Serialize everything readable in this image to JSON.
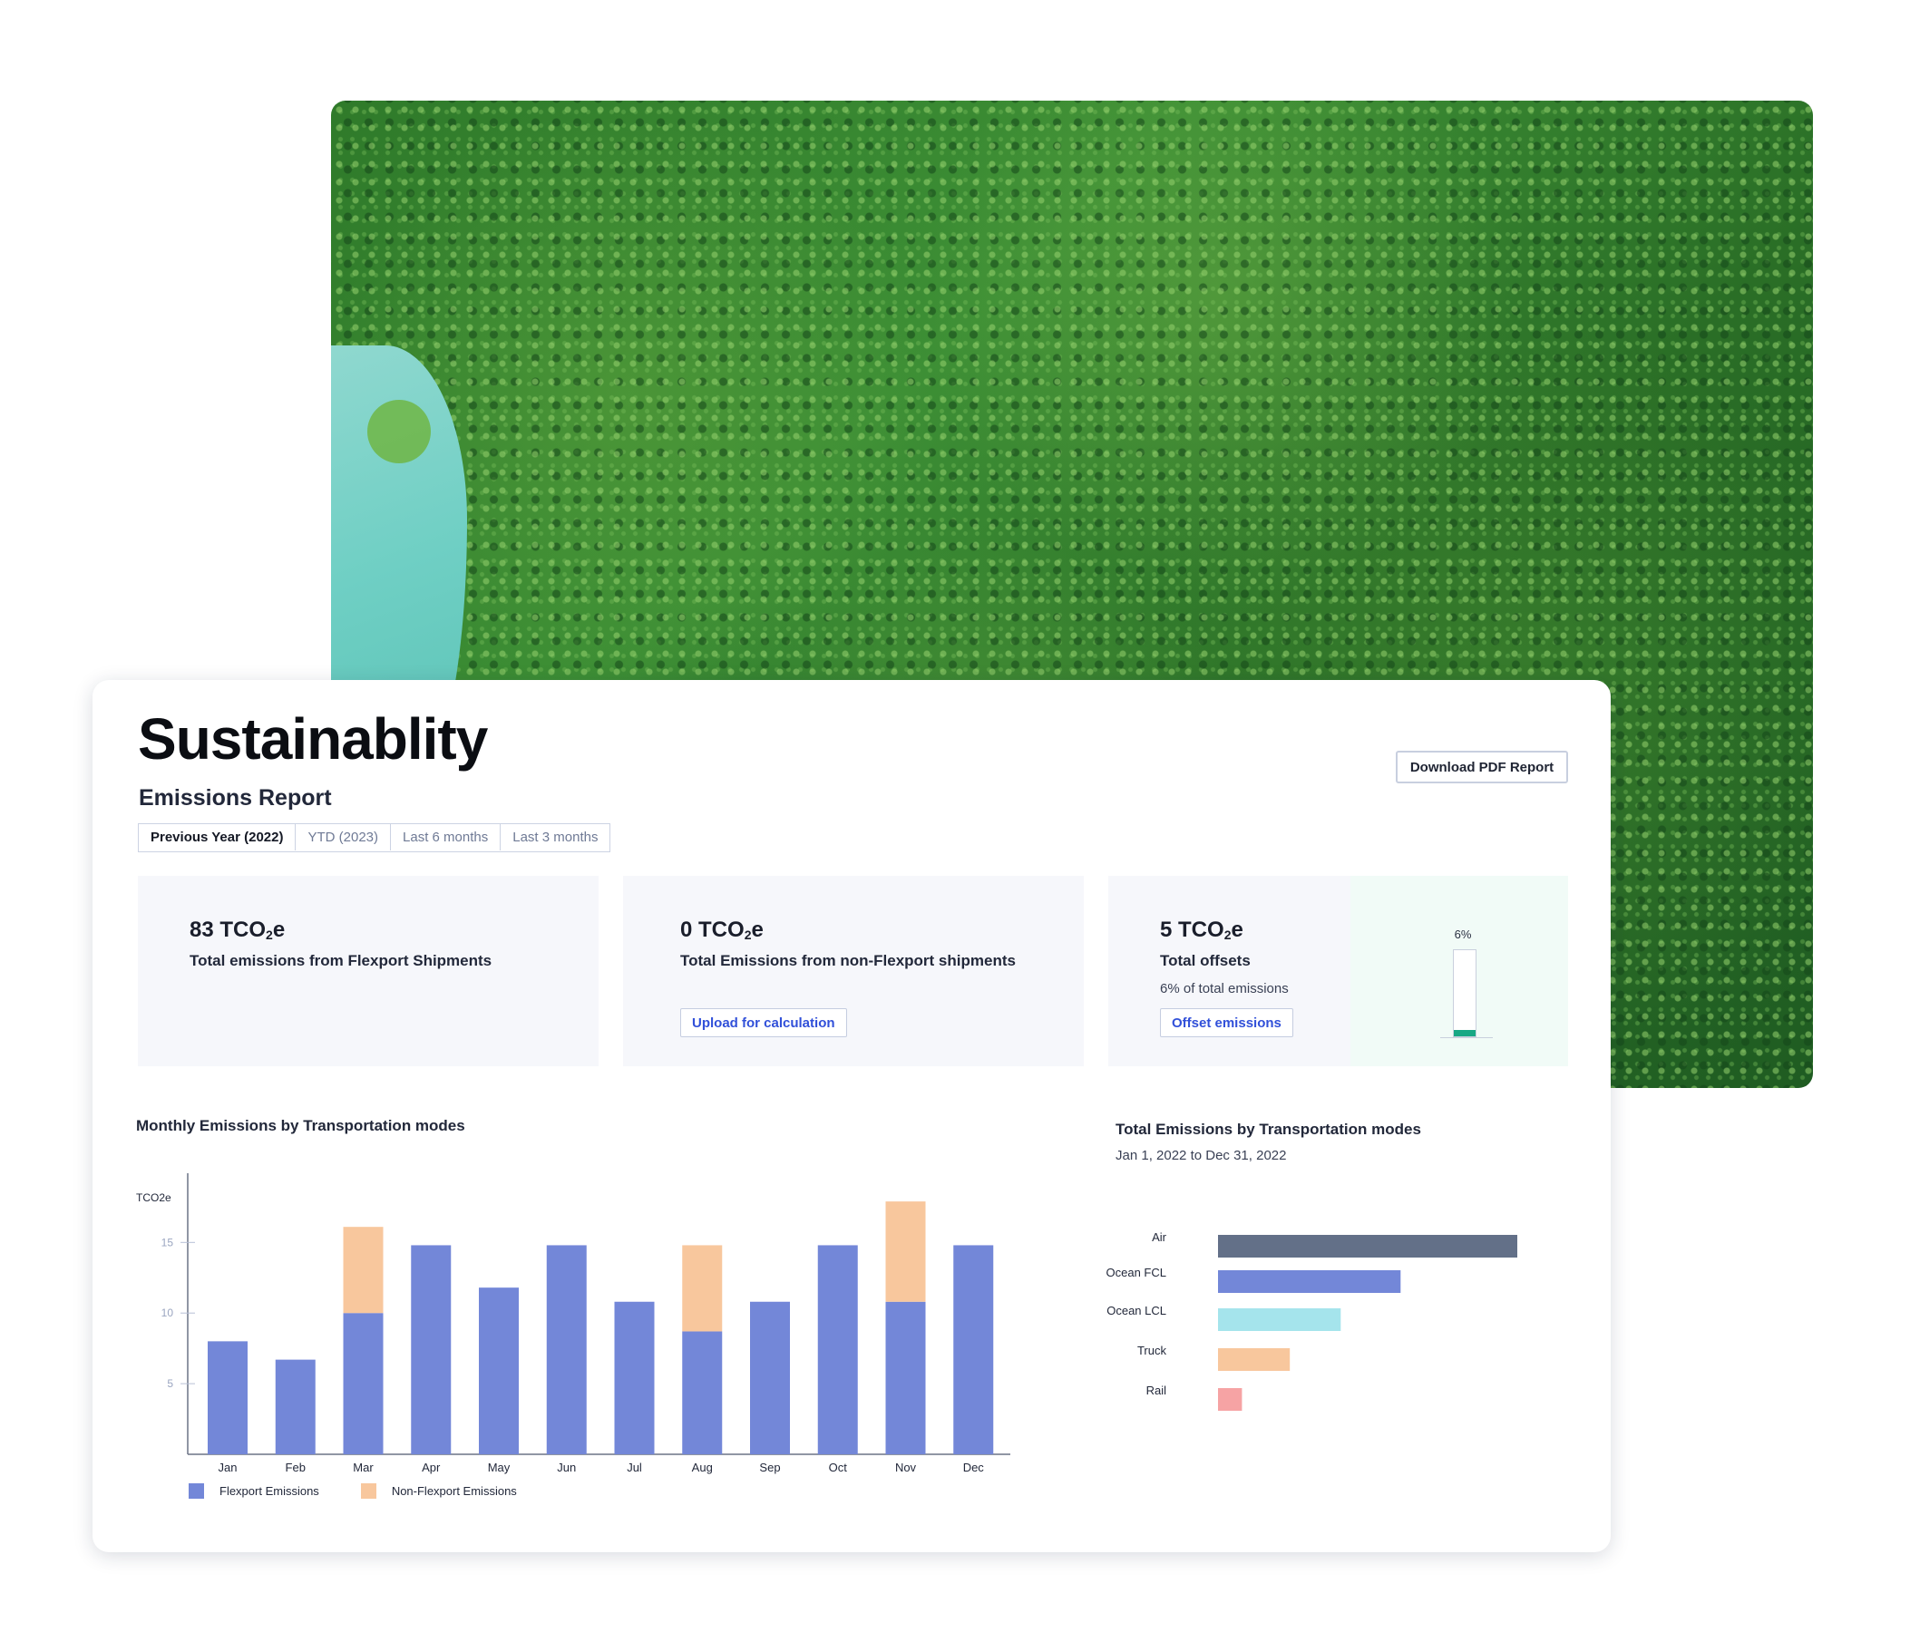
{
  "page": {
    "title": "Sustainablity",
    "subtitle": "Emissions Report",
    "download_label": "Download PDF Report"
  },
  "tabs": [
    {
      "label": "Previous Year (2022)",
      "active": true
    },
    {
      "label": "YTD (2023)",
      "active": false
    },
    {
      "label": "Last 6 months",
      "active": false
    },
    {
      "label": "Last 3 months",
      "active": false
    }
  ],
  "stats": {
    "flexport": {
      "value": "83 TCO",
      "sub": "2",
      "unit_tail": "e",
      "label": "Total emissions from Flexport Shipments"
    },
    "non_flexport": {
      "value": "0 TCO",
      "sub": "2",
      "unit_tail": "e",
      "label": "Total Emissions from non-Flexport shipments",
      "action": "Upload for calculation"
    },
    "offsets": {
      "value": "5 TCO",
      "sub": "2",
      "unit_tail": "e",
      "label": "Total offsets",
      "note": "6% of total emissions",
      "action": "Offset emissions",
      "percent_label": "6%",
      "percent": 6
    }
  },
  "colors": {
    "flexport": "#7387d8",
    "non_flexport": "#f8c79d",
    "offset_fill": "#17a884",
    "axis": "#6b7385",
    "forest": "#2f7a2a"
  },
  "monthly": {
    "title": "Monthly Emissions by Transportation modes",
    "legend_flexport": "Flexport Emissions",
    "legend_non_flexport": "Non-Flexport Emissions"
  },
  "totals": {
    "title": "Total Emissions by Transportation modes",
    "range": "Jan 1, 2022 to Dec 31, 2022"
  },
  "chart_data": [
    {
      "type": "bar",
      "stacked": true,
      "title": "Monthly Emissions by Transportation modes",
      "ylabel": "TCO2e",
      "xlabel": "",
      "categories": [
        "Jan",
        "Feb",
        "Mar",
        "Apr",
        "May",
        "Jun",
        "Jul",
        "Aug",
        "Sep",
        "Oct",
        "Nov",
        "Dec"
      ],
      "ylim": [
        0,
        19
      ],
      "yticks": [
        5,
        10,
        15
      ],
      "series": [
        {
          "name": "Flexport Emissions",
          "values": [
            8,
            6.7,
            10,
            14.8,
            11.8,
            14.8,
            10.8,
            8.7,
            10.8,
            14.8,
            10.8,
            14.8
          ]
        },
        {
          "name": "Non-Flexport Emissions",
          "values": [
            0,
            0,
            6.1,
            0,
            0,
            0,
            0,
            6.1,
            0,
            0,
            7.1,
            0
          ]
        }
      ],
      "legend": "bottom-left",
      "grid": false
    },
    {
      "type": "bar",
      "orientation": "horizontal",
      "title": "Total Emissions by Transportation modes",
      "subtitle": "Jan 1, 2022 to Dec 31, 2022",
      "categories": [
        "Air",
        "Ocean FCL",
        "Ocean LCL",
        "Truck",
        "Rail"
      ],
      "values": [
        100,
        61,
        41,
        24,
        8
      ],
      "colors": [
        "#637088",
        "#7387d8",
        "#a5e4ec",
        "#f8c79d",
        "#f6a3a4"
      ],
      "grid": false
    }
  ]
}
